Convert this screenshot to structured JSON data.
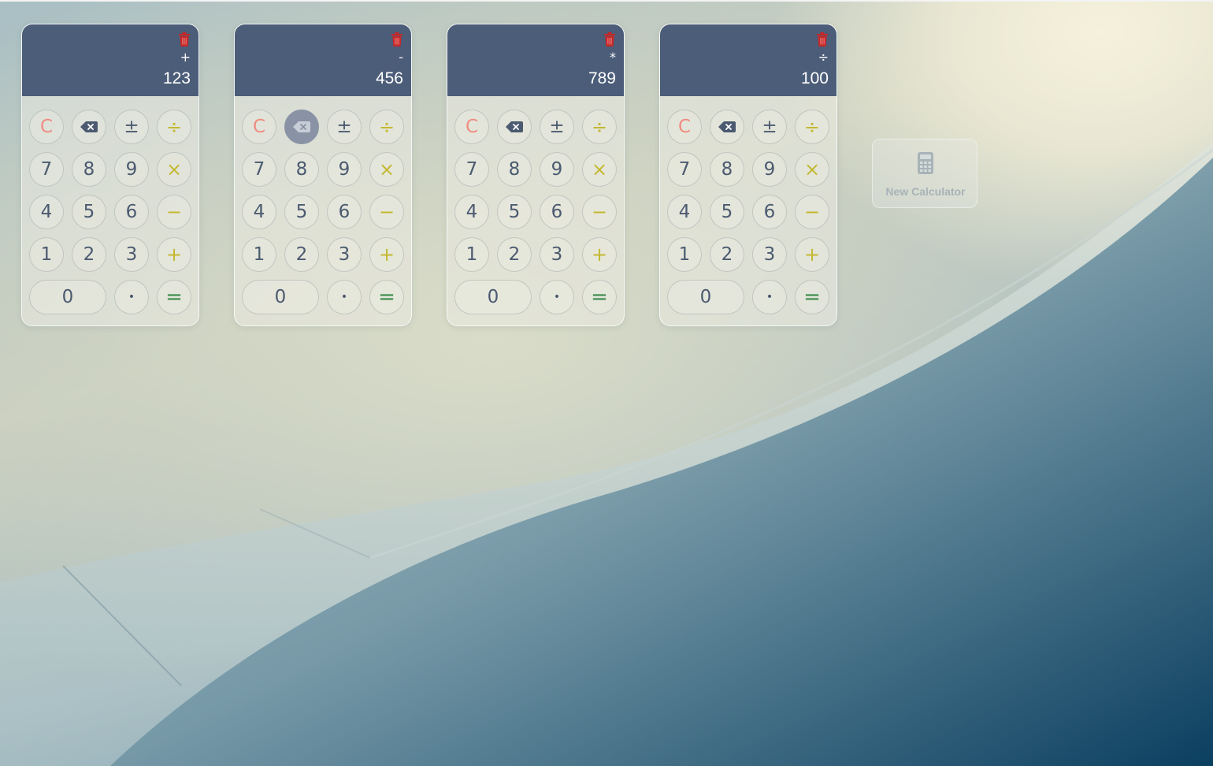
{
  "accent": {
    "display_bg": "#4c5d79",
    "trash": "#c62828",
    "clear": "#f08c82",
    "operator": "#c4b830",
    "equals": "#3a8a48",
    "active_key": "#8993a5"
  },
  "calculators": [
    {
      "op": "+",
      "value": "123",
      "active_key": ""
    },
    {
      "op": "-",
      "value": "456",
      "active_key": "backspace"
    },
    {
      "op": "*",
      "value": "789",
      "active_key": ""
    },
    {
      "op": "÷",
      "value": "100",
      "active_key": ""
    }
  ],
  "keypad": {
    "clear": "C",
    "backspace_icon": "backspace-icon",
    "plus_minus": "±",
    "divide": "÷",
    "seven": "7",
    "eight": "8",
    "nine": "9",
    "multiply": "×",
    "four": "4",
    "five": "5",
    "six": "6",
    "minus": "−",
    "one": "1",
    "two": "2",
    "three": "3",
    "plus": "+",
    "zero": "0",
    "dot": "•",
    "equals": "="
  },
  "new_calculator": {
    "icon": "calculator-icon",
    "label": "New Calculator"
  },
  "icons": {
    "delete": "trash-icon"
  }
}
